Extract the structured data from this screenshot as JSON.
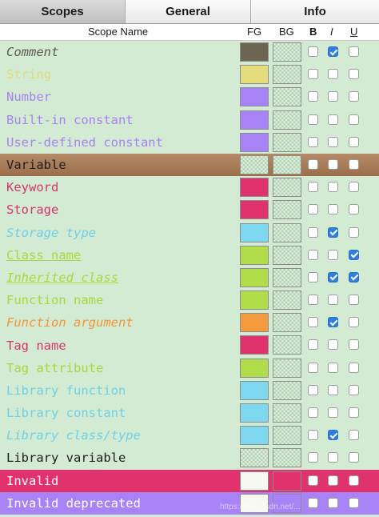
{
  "tabs": [
    {
      "label": "Scopes",
      "active": true
    },
    {
      "label": "General",
      "active": false
    },
    {
      "label": "Info",
      "active": false
    }
  ],
  "columns": {
    "scope": "Scope Name",
    "fg": "FG",
    "bg": "BG",
    "b": "B",
    "i": "I",
    "u": "U"
  },
  "rows": [
    {
      "name": "Comment",
      "color": "#5f5a4a",
      "italic": true,
      "underline": false,
      "bold": false,
      "fg": "#6b6552",
      "bg": null,
      "row_bg": null,
      "checks": [
        false,
        true,
        false
      ]
    },
    {
      "name": "String",
      "color": "#e2d978",
      "italic": false,
      "underline": false,
      "bold": false,
      "fg": "#e5dc7d",
      "bg": null,
      "row_bg": null,
      "checks": [
        false,
        false,
        false
      ]
    },
    {
      "name": "Number",
      "color": "#a882f5",
      "italic": false,
      "underline": false,
      "bold": false,
      "fg": "#a883f7",
      "bg": null,
      "row_bg": null,
      "checks": [
        false,
        false,
        false
      ]
    },
    {
      "name": "Built-in constant",
      "color": "#a882f5",
      "italic": false,
      "underline": false,
      "bold": false,
      "fg": "#a883f7",
      "bg": null,
      "row_bg": null,
      "checks": [
        false,
        false,
        false
      ]
    },
    {
      "name": "User-defined constant",
      "color": "#a882f5",
      "italic": false,
      "underline": false,
      "bold": false,
      "fg": "#a883f7",
      "bg": null,
      "row_bg": null,
      "checks": [
        false,
        false,
        false
      ]
    },
    {
      "name": "Variable",
      "color": "#1e1e1e",
      "italic": false,
      "underline": false,
      "bold": false,
      "fg": null,
      "bg": null,
      "row_bg": "#a87a57",
      "checks": [
        false,
        false,
        false
      ]
    },
    {
      "name": "Keyword",
      "color": "#d8336a",
      "italic": false,
      "underline": false,
      "bold": false,
      "fg": "#e0336d",
      "bg": null,
      "row_bg": null,
      "checks": [
        false,
        false,
        false
      ]
    },
    {
      "name": "Storage",
      "color": "#d8336a",
      "italic": false,
      "underline": false,
      "bold": false,
      "fg": "#e0336d",
      "bg": null,
      "row_bg": null,
      "checks": [
        false,
        false,
        false
      ]
    },
    {
      "name": "Storage type",
      "color": "#6fd0ea",
      "italic": true,
      "underline": false,
      "bold": false,
      "fg": "#7dd8f0",
      "bg": null,
      "row_bg": null,
      "checks": [
        false,
        true,
        false
      ]
    },
    {
      "name": "Class name",
      "color": "#a8d83c",
      "italic": false,
      "underline": true,
      "bold": false,
      "fg": "#b2dd4a",
      "bg": null,
      "row_bg": null,
      "checks": [
        false,
        false,
        true
      ]
    },
    {
      "name": "Inherited class",
      "color": "#a8d83c",
      "italic": true,
      "underline": true,
      "bold": false,
      "fg": "#b2dd4a",
      "bg": null,
      "row_bg": null,
      "checks": [
        false,
        true,
        true
      ]
    },
    {
      "name": "Function name",
      "color": "#a8d83c",
      "italic": false,
      "underline": false,
      "bold": false,
      "fg": "#b2dd4a",
      "bg": null,
      "row_bg": null,
      "checks": [
        false,
        false,
        false
      ]
    },
    {
      "name": "Function argument",
      "color": "#f0963a",
      "italic": true,
      "underline": false,
      "bold": false,
      "fg": "#f39a3d",
      "bg": null,
      "row_bg": null,
      "checks": [
        false,
        true,
        false
      ]
    },
    {
      "name": "Tag name",
      "color": "#d8336a",
      "italic": false,
      "underline": false,
      "bold": false,
      "fg": "#e0336d",
      "bg": null,
      "row_bg": null,
      "checks": [
        false,
        false,
        false
      ]
    },
    {
      "name": "Tag attribute",
      "color": "#a8d83c",
      "italic": false,
      "underline": false,
      "bold": false,
      "fg": "#b2dd4a",
      "bg": null,
      "row_bg": null,
      "checks": [
        false,
        false,
        false
      ]
    },
    {
      "name": "Library function",
      "color": "#6fd0ea",
      "italic": false,
      "underline": false,
      "bold": false,
      "fg": "#7dd8f0",
      "bg": null,
      "row_bg": null,
      "checks": [
        false,
        false,
        false
      ]
    },
    {
      "name": "Library constant",
      "color": "#6fd0ea",
      "italic": false,
      "underline": false,
      "bold": false,
      "fg": "#7dd8f0",
      "bg": null,
      "row_bg": null,
      "checks": [
        false,
        false,
        false
      ]
    },
    {
      "name": "Library class/type",
      "color": "#6fd0ea",
      "italic": true,
      "underline": false,
      "bold": false,
      "fg": "#7dd8f0",
      "bg": null,
      "row_bg": null,
      "checks": [
        false,
        true,
        false
      ]
    },
    {
      "name": "Library variable",
      "color": "#1e1e1e",
      "italic": false,
      "underline": false,
      "bold": false,
      "fg": null,
      "bg": null,
      "row_bg": null,
      "checks": [
        false,
        false,
        false
      ]
    },
    {
      "name": "Invalid",
      "color": "#ffffff",
      "italic": false,
      "underline": false,
      "bold": false,
      "fg": "#f8f8f2",
      "bg": "#e0336d",
      "row_bg": "#e0336d",
      "checks": [
        false,
        false,
        false
      ]
    },
    {
      "name": "Invalid deprecated",
      "color": "#ffffff",
      "italic": false,
      "underline": false,
      "bold": false,
      "fg": "#f8f8f2",
      "bg": "#a883f7",
      "row_bg": "#a883f7",
      "checks": [
        false,
        false,
        false
      ]
    }
  ],
  "watermark": "https://blog.csdn.net/..."
}
